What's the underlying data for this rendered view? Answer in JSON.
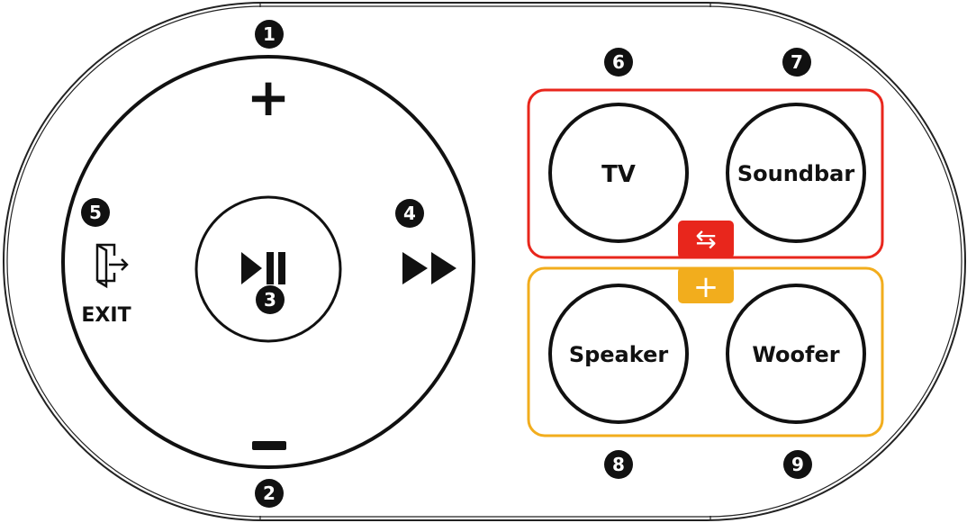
{
  "device": {
    "ring": {
      "volume_up_symbol": "+",
      "volume_down_symbol": "−",
      "play_pause_symbol": "▶❚❚",
      "skip_symbol": "▶▶",
      "exit_label": "EXIT"
    },
    "groups": {
      "swap_symbol": "⇆",
      "add_symbol": "+",
      "colors": {
        "swap_group": "#e8261c",
        "add_group": "#f2ad1d"
      }
    },
    "buttons": {
      "tv": "TV",
      "soundbar": "Soundbar",
      "speaker": "Speaker",
      "woofer": "Woofer"
    },
    "callouts": {
      "n1": "1",
      "n2": "2",
      "n3": "3",
      "n4": "4",
      "n5": "5",
      "n6": "6",
      "n7": "7",
      "n8": "8",
      "n9": "9"
    }
  }
}
